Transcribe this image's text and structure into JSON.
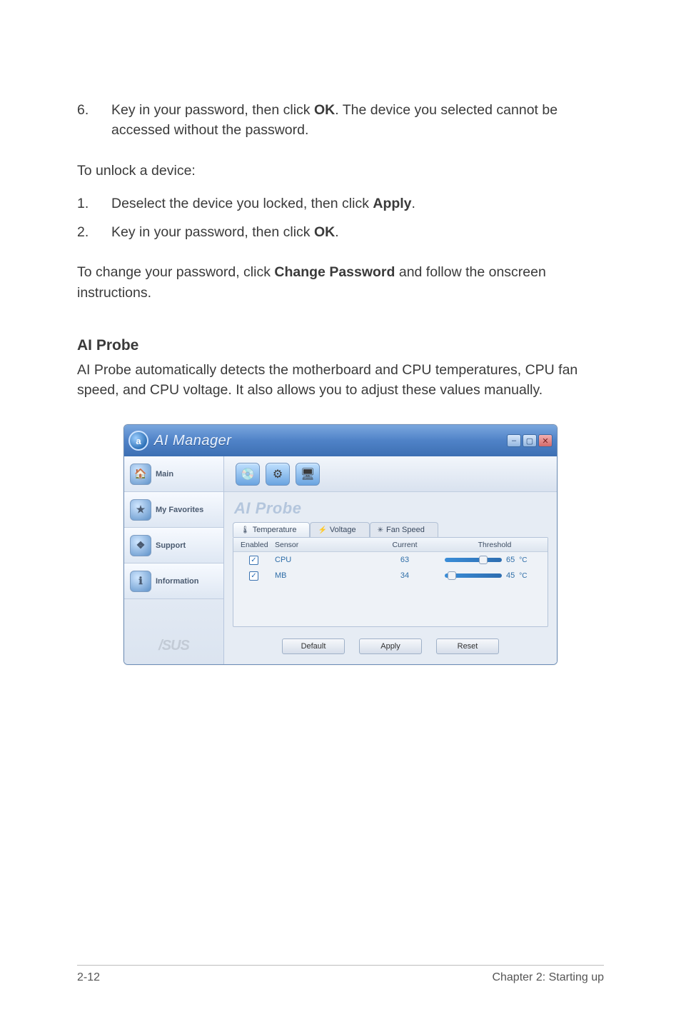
{
  "steps_top": {
    "n6": "6.",
    "t6a": "Key in your password, then click ",
    "t6b": "OK",
    "t6c": ". The device you selected cannot be accessed without the password."
  },
  "unlock_h": "To unlock a device:",
  "unlock": {
    "n1": "1.",
    "t1a": "Deselect the device you locked, then click ",
    "t1b": "Apply",
    "t1c": ".",
    "n2": "2.",
    "t2a": "Key in your password, then click ",
    "t2b": "OK",
    "t2c": "."
  },
  "changepw": {
    "a": "To change your password, click ",
    "b": "Change Password",
    "c": " and follow the onscreen instructions."
  },
  "section_h": "AI Probe",
  "section_desc": "AI Probe automatically detects the motherboard and CPU temperatures, CPU fan speed, and CPU voltage. It also allows you to adjust these values manually.",
  "app": {
    "title": "AI Manager",
    "logo_glyph": "a",
    "sidebar": [
      {
        "label": "Main"
      },
      {
        "label": "My Favorites"
      },
      {
        "label": "Support"
      },
      {
        "label": "Information"
      }
    ],
    "asus": "/SUS",
    "pane_title": "AI Probe",
    "tabs": [
      {
        "label": "Temperature",
        "icon": "🌡"
      },
      {
        "label": "Voltage",
        "icon": "⚡"
      },
      {
        "label": "Fan Speed",
        "icon": "✳"
      }
    ],
    "columns": {
      "enabled": "Enabled",
      "sensor": "Sensor",
      "current": "Current",
      "threshold": "Threshold"
    },
    "rows": [
      {
        "sensor": "CPU",
        "current": "63",
        "threshold": "65",
        "unit": "°C",
        "thumb": 48
      },
      {
        "sensor": "MB",
        "current": "34",
        "threshold": "45",
        "unit": "°C",
        "thumb": 4
      }
    ],
    "buttons": {
      "default": "Default",
      "apply": "Apply",
      "reset": "Reset"
    }
  },
  "footer": {
    "left": "2-12",
    "right": "Chapter 2: Starting up"
  }
}
